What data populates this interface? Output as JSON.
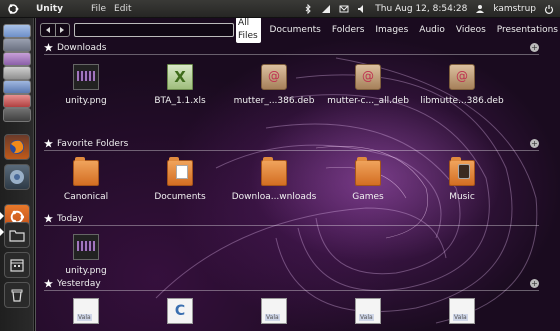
{
  "top_panel": {
    "app_title": "Unity",
    "menus": [
      "File",
      "Edit"
    ],
    "clock": "Thu Aug 12,  8:54:28",
    "user": "kamstrup"
  },
  "search": {
    "value": "",
    "placeholder": ""
  },
  "filters": [
    "All Files",
    "Documents",
    "Folders",
    "Images",
    "Audio",
    "Videos",
    "Presentations"
  ],
  "active_filter": "All Files",
  "sections": {
    "downloads": {
      "title": "Downloads",
      "items": [
        {
          "label": "unity.png",
          "icon": "image-file-icon"
        },
        {
          "label": "BTA_1.1.xls",
          "icon": "spreadsheet-file-icon"
        },
        {
          "label": "mutter_...386.deb",
          "icon": "debian-package-icon"
        },
        {
          "label": "mutter-c..._all.deb",
          "icon": "debian-package-icon"
        },
        {
          "label": "libmutte...386.deb",
          "icon": "debian-package-icon"
        }
      ]
    },
    "favorites": {
      "title": "Favorite Folders",
      "items": [
        {
          "label": "Canonical",
          "icon": "folder-icon"
        },
        {
          "label": "Documents",
          "icon": "folder-documents-icon"
        },
        {
          "label": "Downloa...wnloads",
          "icon": "folder-icon"
        },
        {
          "label": "Games",
          "icon": "folder-icon"
        },
        {
          "label": "Music",
          "icon": "folder-music-icon"
        }
      ]
    },
    "today": {
      "title": "Today",
      "items": [
        {
          "label": "unity.png",
          "icon": "image-file-icon"
        }
      ]
    },
    "yesterday": {
      "title": "Yesterday",
      "items": [
        {
          "label": "",
          "icon": "vala-file-icon"
        },
        {
          "label": "",
          "icon": "c-source-file-icon"
        },
        {
          "label": "",
          "icon": "vala-file-icon"
        },
        {
          "label": "",
          "icon": "vala-file-icon"
        },
        {
          "label": "",
          "icon": "vala-file-icon"
        }
      ]
    }
  },
  "colors": {
    "accent": "#e05a1c",
    "panel": "#2f2f2c"
  }
}
